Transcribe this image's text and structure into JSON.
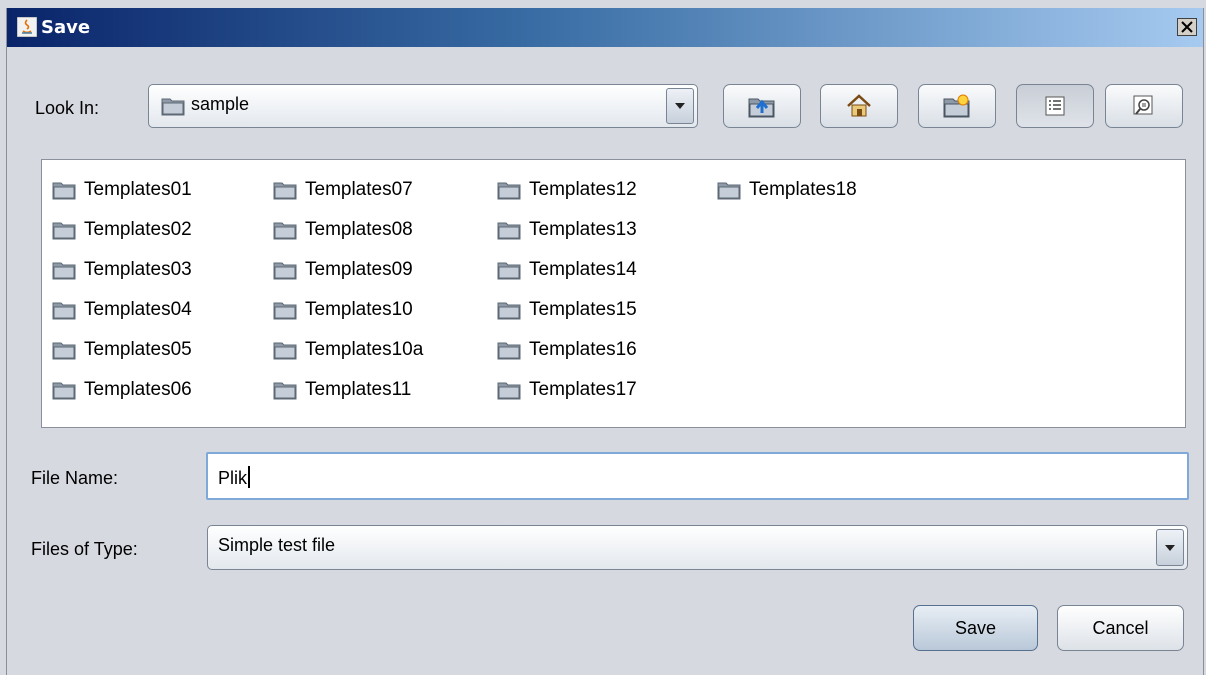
{
  "window": {
    "title": "Save"
  },
  "look_in": {
    "label": "Look In:",
    "value": "sample"
  },
  "toolbar": [
    "up-one-level",
    "home",
    "create-new-folder",
    "list-view",
    "details-view"
  ],
  "folders": [
    [
      "Templates01",
      "Templates02",
      "Templates03",
      "Templates04",
      "Templates05",
      "Templates06"
    ],
    [
      "Templates07",
      "Templates08",
      "Templates09",
      "Templates10",
      "Templates10a",
      "Templates11"
    ],
    [
      "Templates12",
      "Templates13",
      "Templates14",
      "Templates15",
      "Templates16",
      "Templates17"
    ],
    [
      "Templates18"
    ]
  ],
  "file_name": {
    "label": "File Name:",
    "value": "Plik"
  },
  "files_of_type": {
    "label": "Files of Type:",
    "value": "Simple test file"
  },
  "buttons": {
    "save": "Save",
    "cancel": "Cancel"
  }
}
